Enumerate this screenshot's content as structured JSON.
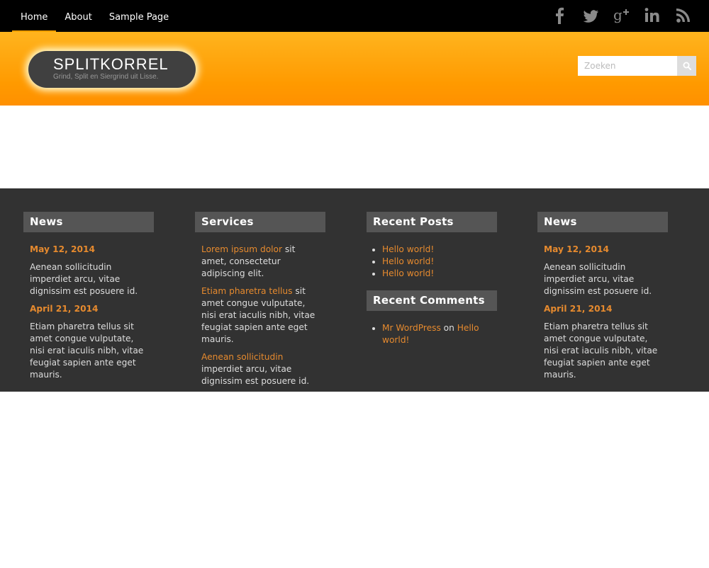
{
  "nav": {
    "items": [
      {
        "label": "Home",
        "active": true
      },
      {
        "label": "About",
        "active": false
      },
      {
        "label": "Sample Page",
        "active": false
      }
    ]
  },
  "social": [
    "facebook-icon",
    "twitter-icon",
    "google-plus-icon",
    "linkedin-icon",
    "rss-icon"
  ],
  "header": {
    "site_title": "SPLITKORREL",
    "tagline": "Grind, Split en Siergrind uit Lisse.",
    "search_placeholder": "Zoeken"
  },
  "footer": {
    "news1": {
      "title": "News",
      "posts": [
        {
          "date": "May 12, 2014",
          "text": "Aenean sollicitudin imperdiet arcu, vitae dignissim est posuere id."
        },
        {
          "date": "April 21, 2014",
          "text": "Etiam pharetra tellus sit amet congue vulputate, nisi erat iaculis nibh, vitae feugiat sapien ante eget mauris."
        }
      ]
    },
    "services": {
      "title": "Services",
      "items": [
        {
          "link": "Lorem ipsum dolor",
          "rest": " sit amet, consectetur adipiscing elit."
        },
        {
          "link": "Etiam pharetra tellus",
          "rest": " sit amet congue vulputate, nisi erat iaculis nibh, vitae feugiat sapien ante eget mauris."
        },
        {
          "link": "Aenean sollicitudin",
          "rest": " imperdiet arcu, vitae dignissim est posuere id."
        }
      ]
    },
    "recent_posts": {
      "title": "Recent Posts",
      "items": [
        "Hello world!",
        "Hello world!",
        "Hello world!"
      ]
    },
    "recent_comments": {
      "title": "Recent Comments",
      "author": "Mr WordPress",
      "on": " on ",
      "post": "Hello world!"
    },
    "news2": {
      "title": "News",
      "posts": [
        {
          "date": "May 12, 2014",
          "text": "Aenean sollicitudin imperdiet arcu, vitae dignissim est posuere id."
        },
        {
          "date": "April 21, 2014",
          "text": "Etiam pharetra tellus sit amet congue vulputate, nisi erat iaculis nibh, vitae feugiat sapien ante eget mauris."
        }
      ]
    }
  },
  "colors": {
    "topbar": "#000000",
    "header_orange": "#ff9a00",
    "accent": "#e68a2e",
    "footer_bg": "#323232",
    "widget_title_bg": "#555555"
  }
}
